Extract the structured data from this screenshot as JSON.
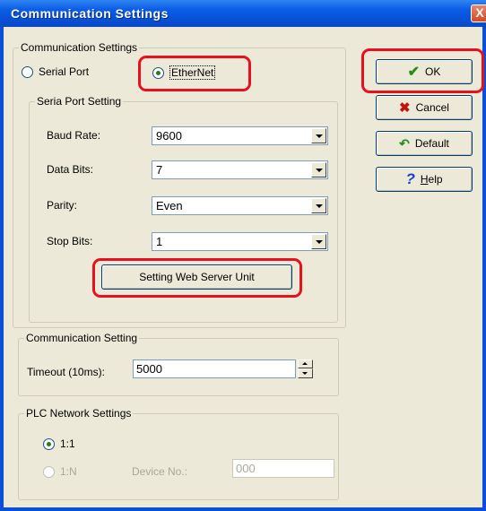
{
  "window": {
    "title": "Communication Settings",
    "close_glyph": "X"
  },
  "comm_group": {
    "legend": "Communication Settings",
    "radio_serial": "Serial Port",
    "radio_ethernet": "EtherNet",
    "selected": "EtherNet"
  },
  "serial_group": {
    "legend": "Seria Port Setting",
    "baud_label": "Baud Rate:",
    "baud_value": "9600",
    "data_bits_label": "Data Bits:",
    "data_bits_value": "7",
    "parity_label": "Parity:",
    "parity_value": "Even",
    "stop_bits_label": "Stop Bits:",
    "stop_bits_value": "1",
    "web_server_button": "Setting Web Server Unit"
  },
  "timeout_group": {
    "legend": "Communication Setting",
    "timeout_label": "Timeout (10ms):",
    "timeout_value": "5000"
  },
  "plc_group": {
    "legend": "PLC Network Settings",
    "radio_1_1": "1:1",
    "radio_1_n": "1:N",
    "selected": "1:1",
    "device_no_label": "Device No.:",
    "device_no_value": "000"
  },
  "buttons": {
    "ok": "OK",
    "cancel": "Cancel",
    "default": "Default",
    "help_accel": "H",
    "help_rest": "elp"
  },
  "icons": {
    "ok": "checkmark-icon",
    "cancel": "x-icon",
    "default": "revert-arrow-icon",
    "help": "question-mark-icon"
  },
  "colors": {
    "title_bar": "#0a4fd8",
    "dialog_face": "#ece9d8",
    "highlight": "#e8101c",
    "ok_check": "#2b8a1e",
    "cancel_x": "#c0140a",
    "help_question": "#1a3ec8"
  }
}
